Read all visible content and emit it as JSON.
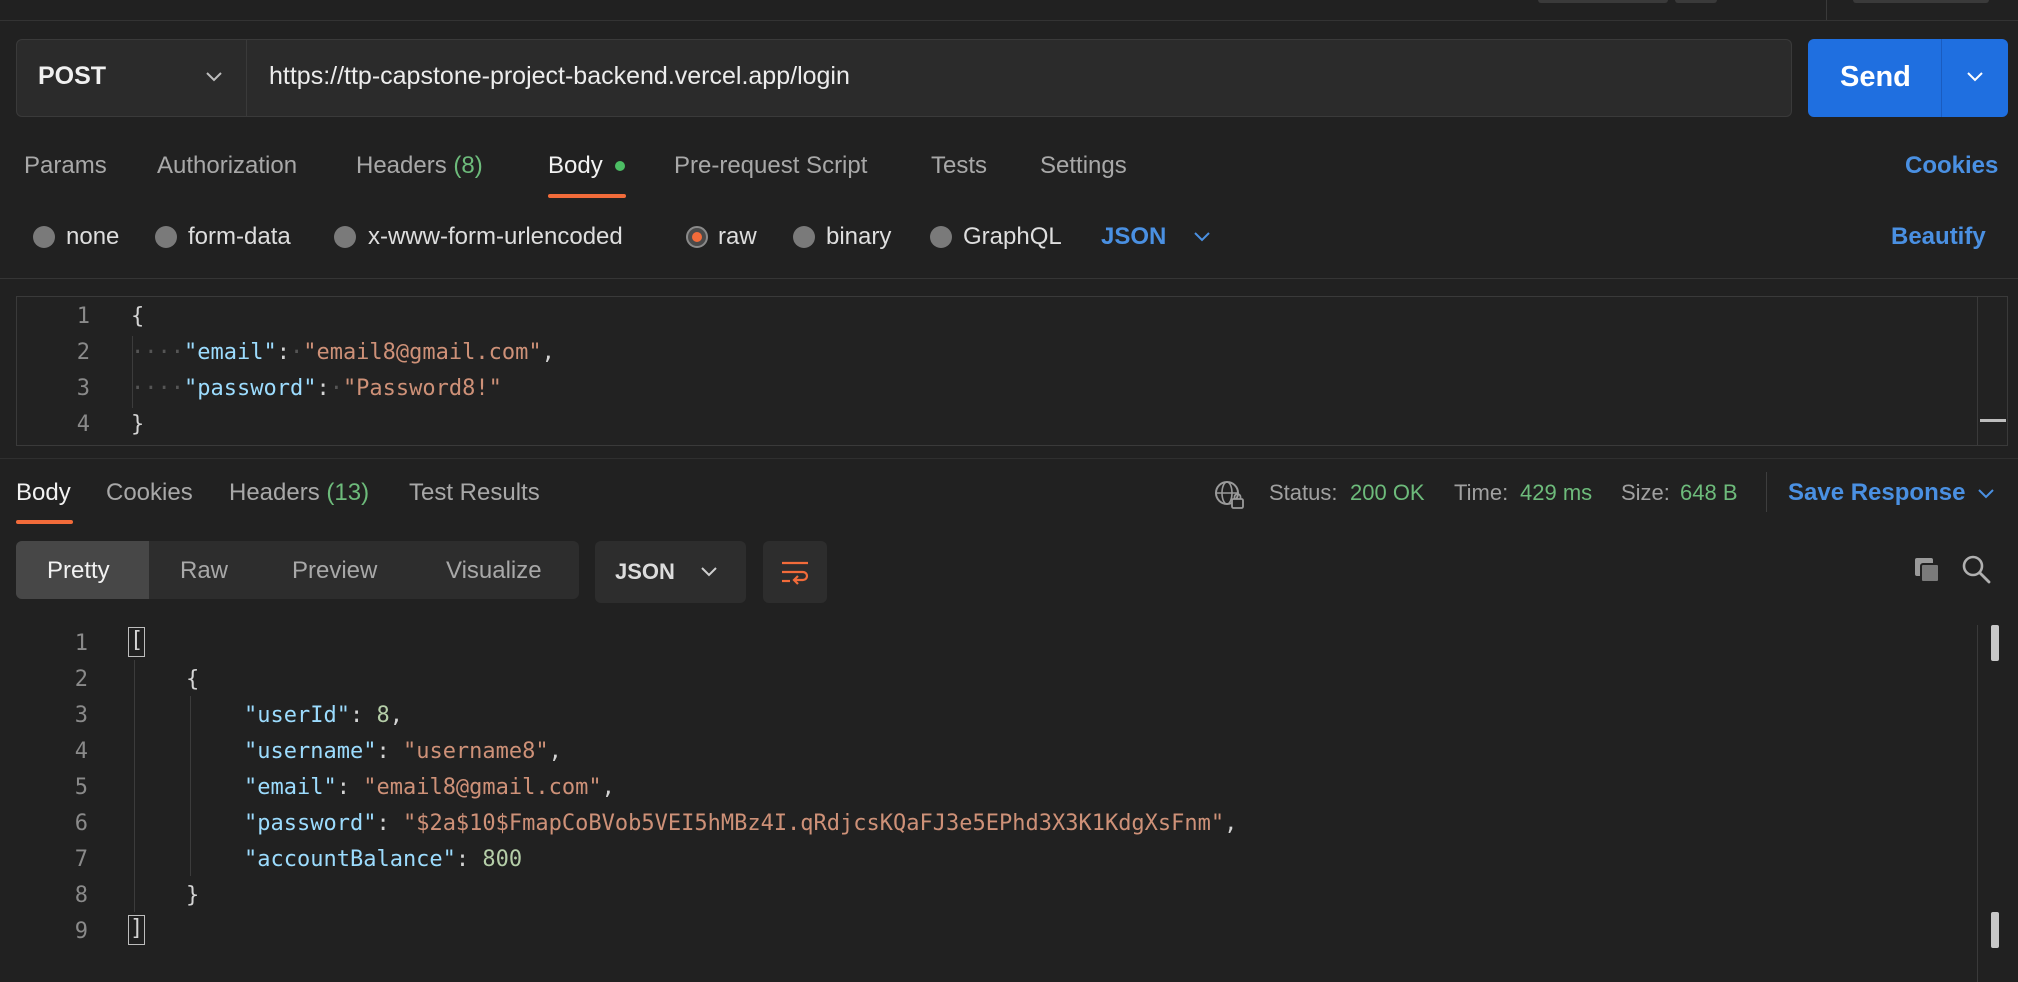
{
  "request": {
    "method": "POST",
    "url": "https://ttp-capstone-project-backend.vercel.app/login",
    "send_label": "Send"
  },
  "request_tabs": {
    "params": "Params",
    "authorization": "Authorization",
    "headers_label": "Headers",
    "headers_count": "(8)",
    "body": "Body",
    "prerequest": "Pre-request Script",
    "tests": "Tests",
    "settings": "Settings",
    "cookies": "Cookies"
  },
  "body_types": {
    "none": "none",
    "form_data": "form-data",
    "urlencoded": "x-www-form-urlencoded",
    "raw": "raw",
    "binary": "binary",
    "graphql": "GraphQL",
    "format": "JSON",
    "beautify": "Beautify",
    "selected": "raw"
  },
  "request_body": {
    "line_numbers": [
      "1",
      "2",
      "3",
      "4"
    ],
    "open_brace": "{",
    "close_brace": "}",
    "email_key": "\"email\"",
    "email_value": "\"email8@gmail.com\"",
    "password_key": "\"password\"",
    "password_value": "\"Password8!\""
  },
  "response_tabs": {
    "body": "Body",
    "cookies": "Cookies",
    "headers_label": "Headers",
    "headers_count": "(13)",
    "test_results": "Test Results"
  },
  "response_status": {
    "status_label": "Status:",
    "status_value": "200 OK",
    "time_label": "Time:",
    "time_value": "429 ms",
    "size_label": "Size:",
    "size_value": "648 B",
    "save_response": "Save Response"
  },
  "response_view": {
    "modes": [
      "Pretty",
      "Raw",
      "Preview",
      "Visualize"
    ],
    "active_mode": "Pretty",
    "format": "JSON"
  },
  "response_body": {
    "line_numbers": [
      "1",
      "2",
      "3",
      "4",
      "5",
      "6",
      "7",
      "8",
      "9"
    ],
    "open_bracket": "[",
    "close_bracket": "]",
    "open_brace": "{",
    "close_brace": "}",
    "userId_key": "\"userId\"",
    "userId_value": "8",
    "username_key": "\"username\"",
    "username_value": "\"username8\"",
    "email_key": "\"email\"",
    "email_value": "\"email8@gmail.com\"",
    "password_key": "\"password\"",
    "password_value": "\"$2a$10$FmapCoBVob5VEI5hMBz4I.qRdjcsKQaFJ3e5EPhd3X3K1KdgXsFnm\"",
    "accountBalance_key": "\"accountBalance\"",
    "accountBalance_value": "800"
  },
  "colors": {
    "accent_orange": "#f26b3a",
    "link_blue": "#4a90e2",
    "send_blue": "#1f6fe0",
    "success_green": "#6dbb7b",
    "json_key": "#9cdcfe",
    "json_string": "#ce9178",
    "json_number": "#b5cea8"
  },
  "icons": {
    "method_dropdown": "chevron-down-icon",
    "send_dropdown": "chevron-down-icon",
    "network": "globe-lock-icon",
    "wrap": "wrap-lines-icon",
    "copy": "copy-icon",
    "search": "search-icon"
  }
}
